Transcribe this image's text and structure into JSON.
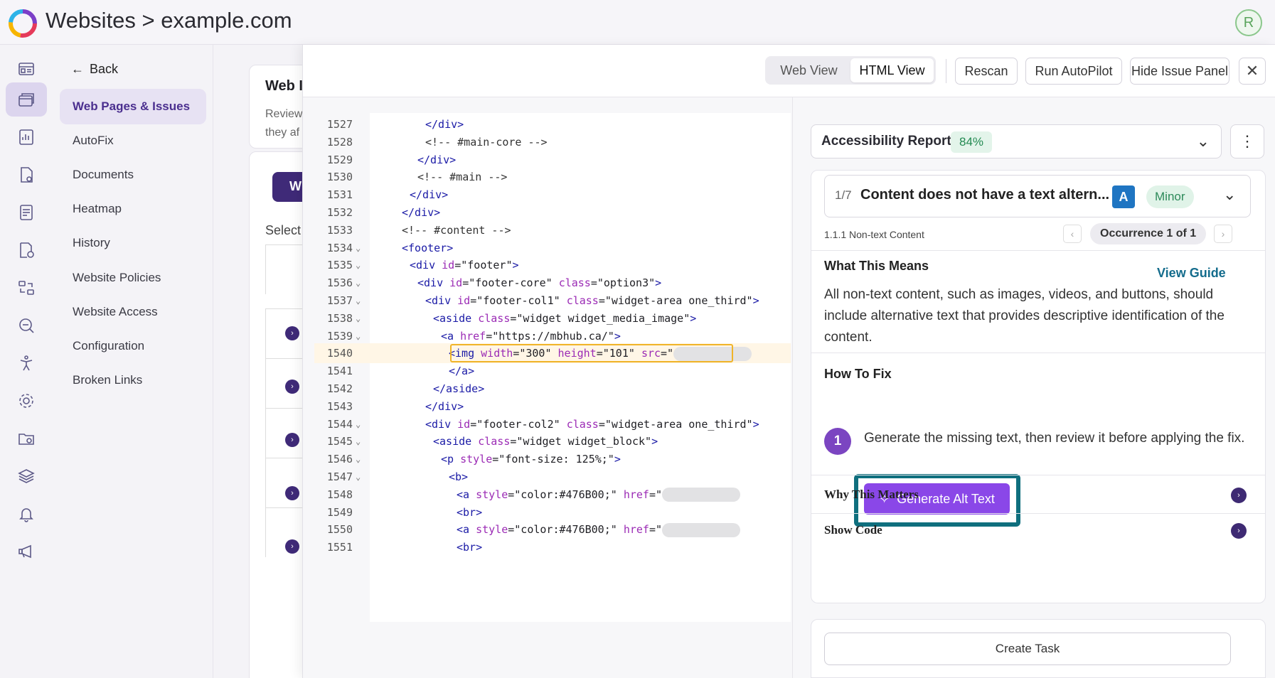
{
  "header": {
    "breadcrumb": "Websites > example.com",
    "avatar_initial": "R"
  },
  "rail_icons": [
    "dashboard-icon",
    "websites-icon",
    "reports-icon",
    "document-settings-icon",
    "document-icon",
    "document-accessibility-icon",
    "compare-icon",
    "search-analysis-icon",
    "accessibility-icon",
    "settings-icon",
    "folder-settings-icon",
    "layers-icon",
    "bell-icon",
    "announcement-icon"
  ],
  "subnav": {
    "back_label": "Back",
    "items": [
      "Web Pages & Issues",
      "AutoFix",
      "Documents",
      "Heatmap",
      "History",
      "Website Policies",
      "Website Access",
      "Configuration",
      "Broken Links"
    ]
  },
  "background": {
    "card_title": "Web I",
    "card_desc_1": "Review",
    "card_desc_2": "they af",
    "button_label": "W",
    "select_label": "Select"
  },
  "panel": {
    "view_tabs": [
      "Web View",
      "HTML View"
    ],
    "active_tab": "HTML View",
    "rescan": "Rescan",
    "autopilot": "Run AutoPilot",
    "hide_issue": "Hide Issue Panel",
    "close": "✕"
  },
  "code": {
    "highlight_line": 1540,
    "lines": [
      {
        "n": "1527",
        "fold": "",
        "indent": 6,
        "parts": [
          [
            "tag",
            "</div>"
          ]
        ]
      },
      {
        "n": "1528",
        "fold": "",
        "indent": 6,
        "parts": [
          [
            "cmt",
            "<!-- #main-core -->"
          ]
        ]
      },
      {
        "n": "1529",
        "fold": "",
        "indent": 5,
        "parts": [
          [
            "tag",
            "</div>"
          ]
        ]
      },
      {
        "n": "1530",
        "fold": "",
        "indent": 5,
        "parts": [
          [
            "cmt",
            "<!-- #main -->"
          ]
        ]
      },
      {
        "n": "1531",
        "fold": "",
        "indent": 4,
        "parts": [
          [
            "tag",
            "</div>"
          ]
        ]
      },
      {
        "n": "1532",
        "fold": "",
        "indent": 3,
        "parts": [
          [
            "tag",
            "</div>"
          ]
        ]
      },
      {
        "n": "1533",
        "fold": "",
        "indent": 3,
        "parts": [
          [
            "cmt",
            "<!-- #content -->"
          ]
        ]
      },
      {
        "n": "1534",
        "fold": "⌄",
        "indent": 3,
        "parts": [
          [
            "tag",
            "<footer>"
          ]
        ]
      },
      {
        "n": "1535",
        "fold": "⌄",
        "indent": 4,
        "parts": [
          [
            "tag",
            "<div "
          ],
          [
            "atn",
            "id"
          ],
          [
            "atv",
            "=\"footer\""
          ],
          [
            "tag",
            ">"
          ]
        ]
      },
      {
        "n": "1536",
        "fold": "⌄",
        "indent": 5,
        "parts": [
          [
            "tag",
            "<div "
          ],
          [
            "atn",
            "id"
          ],
          [
            "atv",
            "=\"footer-core\" "
          ],
          [
            "atn",
            "class"
          ],
          [
            "atv",
            "=\"option3\""
          ],
          [
            "tag",
            ">"
          ]
        ]
      },
      {
        "n": "1537",
        "fold": "⌄",
        "indent": 6,
        "parts": [
          [
            "tag",
            "<div "
          ],
          [
            "atn",
            "id"
          ],
          [
            "atv",
            "=\"footer-col1\" "
          ],
          [
            "atn",
            "class"
          ],
          [
            "atv",
            "=\"widget-area one_third\""
          ],
          [
            "tag",
            ">"
          ]
        ]
      },
      {
        "n": "1538",
        "fold": "⌄",
        "indent": 7,
        "parts": [
          [
            "tag",
            "<aside "
          ],
          [
            "atn",
            "class"
          ],
          [
            "atv",
            "=\"widget widget_media_image\""
          ],
          [
            "tag",
            ">"
          ]
        ]
      },
      {
        "n": "1539",
        "fold": "⌄",
        "indent": 8,
        "parts": [
          [
            "tag",
            "<a "
          ],
          [
            "atn",
            "href"
          ],
          [
            "atv",
            "=\"https://mbhub.ca/\""
          ],
          [
            "tag",
            ">"
          ]
        ]
      },
      {
        "n": "1540",
        "fold": "",
        "indent": 9,
        "parts": [
          [
            "tag",
            "<img "
          ],
          [
            "atn",
            "width"
          ],
          [
            "atv",
            "=\"300\" "
          ],
          [
            "atn",
            "height"
          ],
          [
            "atv",
            "=\"101\" "
          ],
          [
            "atn",
            "src"
          ],
          [
            "atv",
            "=\""
          ],
          [
            "blur",
            ""
          ]
        ]
      },
      {
        "n": "1541",
        "fold": "",
        "indent": 9,
        "parts": [
          [
            "tag",
            "</a>"
          ]
        ]
      },
      {
        "n": "1542",
        "fold": "",
        "indent": 7,
        "parts": [
          [
            "tag",
            "</aside>"
          ]
        ]
      },
      {
        "n": "1543",
        "fold": "",
        "indent": 6,
        "parts": [
          [
            "tag",
            "</div>"
          ]
        ]
      },
      {
        "n": "1544",
        "fold": "⌄",
        "indent": 6,
        "parts": [
          [
            "tag",
            "<div "
          ],
          [
            "atn",
            "id"
          ],
          [
            "atv",
            "=\"footer-col2\" "
          ],
          [
            "atn",
            "class"
          ],
          [
            "atv",
            "=\"widget-area one_third\""
          ],
          [
            "tag",
            ">"
          ]
        ]
      },
      {
        "n": "1545",
        "fold": "⌄",
        "indent": 7,
        "parts": [
          [
            "tag",
            "<aside "
          ],
          [
            "atn",
            "class"
          ],
          [
            "atv",
            "=\"widget widget_block\""
          ],
          [
            "tag",
            ">"
          ]
        ]
      },
      {
        "n": "1546",
        "fold": "⌄",
        "indent": 8,
        "parts": [
          [
            "tag",
            "<p "
          ],
          [
            "atn",
            "style"
          ],
          [
            "atv",
            "=\"font-size: 125%;\""
          ],
          [
            "tag",
            ">"
          ]
        ]
      },
      {
        "n": "1547",
        "fold": "⌄",
        "indent": 9,
        "parts": [
          [
            "tag",
            "<b>"
          ]
        ]
      },
      {
        "n": "1548",
        "fold": "",
        "indent": 10,
        "parts": [
          [
            "tag",
            "<a "
          ],
          [
            "atn",
            "style"
          ],
          [
            "atv",
            "=\"color:#476B00;\" "
          ],
          [
            "atn",
            "href"
          ],
          [
            "atv",
            "=\""
          ],
          [
            "blur",
            ""
          ]
        ]
      },
      {
        "n": "1549",
        "fold": "",
        "indent": 10,
        "parts": [
          [
            "tag",
            "<br>"
          ]
        ]
      },
      {
        "n": "1550",
        "fold": "",
        "indent": 10,
        "parts": [
          [
            "tag",
            "<a "
          ],
          [
            "atn",
            "style"
          ],
          [
            "atv",
            "=\"color:#476B00;\" "
          ],
          [
            "atn",
            "href"
          ],
          [
            "atv",
            "=\""
          ],
          [
            "blur",
            ""
          ]
        ]
      },
      {
        "n": "1551",
        "fold": "",
        "indent": 10,
        "parts": [
          [
            "tag",
            "<br>"
          ]
        ]
      }
    ]
  },
  "report": {
    "label": "Accessibility Report",
    "score": "84%"
  },
  "issue": {
    "counter": "1/7",
    "title": "Content does not have a text altern...",
    "level": "A",
    "severity": "Minor",
    "criterion": "1.1.1 Non-text Content",
    "occurrence": "Occurrence 1 of 1",
    "what_title": "What This Means",
    "view_guide": "View Guide",
    "what_text": "All non-text content, such as images, videos, and buttons, should include alternative text that provides descriptive identification of the content.",
    "how_title": "How To Fix",
    "step_number": "1",
    "step_text": "Generate the missing text, then review it before applying the fix.",
    "generate_label": "Generate Alt Text",
    "why_title": "Why This Matters",
    "code_title": "Show Code"
  },
  "task": {
    "label": "Create Task"
  },
  "colors": {
    "accent": "#8a47e8",
    "brand": "#3f2a78",
    "highlight_frame": "#0f6f7e"
  }
}
